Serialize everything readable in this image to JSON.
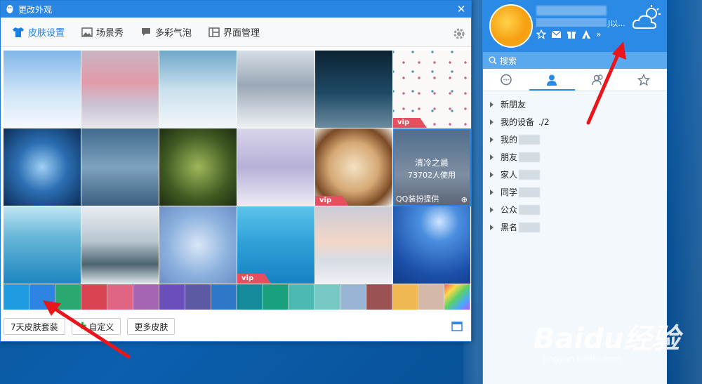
{
  "skin_window": {
    "title": "更改外观",
    "close": "✕",
    "tabs": [
      {
        "label": "皮肤设置",
        "icon": "shirt-icon",
        "active": true
      },
      {
        "label": "场景秀",
        "icon": "picture-icon",
        "active": false
      },
      {
        "label": "多彩气泡",
        "icon": "bubble-icon",
        "active": false
      },
      {
        "label": "界面管理",
        "icon": "layout-icon",
        "active": false
      }
    ],
    "tiles": [
      {
        "name": "sky-clouds",
        "bg": "linear-gradient(180deg,#7fb6e8 0%,#cfe4f7 55%,#f5f9fd 100%)",
        "vip": false
      },
      {
        "name": "snowy-street",
        "bg": "linear-gradient(180deg,#c7b5c4 0%,#e39aa8 40%,#c9c2d3 70%,#e8e6ec 100%)",
        "vip": false
      },
      {
        "name": "snowman",
        "bg": "linear-gradient(180deg,#6fa8c9 0%,#c9e0ee 50%,#f2f6f9 100%)",
        "vip": false
      },
      {
        "name": "snow-forest",
        "bg": "linear-gradient(180deg,#d6dee6 0%,#9aa8b6 45%,#eef1f4 100%)",
        "vip": false
      },
      {
        "name": "night-lamp",
        "bg": "linear-gradient(180deg,#0c2233 0%,#1f4a66 55%,#6b8ba0 100%)",
        "vip": false
      },
      {
        "name": "dots-pattern",
        "bg": "#fbf8f8",
        "vip": true
      },
      {
        "name": "snowflake-blue",
        "bg": "radial-gradient(circle at 50% 50%,#9fd0f5 0%,#2c6fb3 45%,#0b2d58 100%)",
        "vip": false
      },
      {
        "name": "merry-christmas",
        "bg": "linear-gradient(180deg,#3f6a8e 0%,#7fa2be 50%,#3c5f80 100%)",
        "vip": false
      },
      {
        "name": "pine-branch",
        "bg": "radial-gradient(circle at 50% 50%,#9fb75a 0%,#3f5a22 60%,#1e2d12 100%)",
        "vip": false
      },
      {
        "name": "couple-snow",
        "bg": "linear-gradient(180deg,#d8d4ea 0%,#b7b0d8 50%,#ecebf5 100%)",
        "vip": false
      },
      {
        "name": "latte-snowflake",
        "bg": "radial-gradient(circle at 50% 50%,#f3e2c4 0%,#d6a975 45%,#7a4a25 75%,#efe8df 100%)",
        "vip": true
      },
      {
        "name": "cold-morning",
        "bg": "linear-gradient(180deg,#4f6d8c 0%,#7e8ea2 60%,#5b6677 100%)",
        "vip": false,
        "selected": true,
        "title": "清冷之晨",
        "sub": "73702人使用",
        "provider": "QQ装扮提供",
        "zoom": "⊕"
      },
      {
        "name": "frozen-tree",
        "bg": "linear-gradient(180deg,#bfe6f3 0%,#66b6d8 40%,#1e86bf 100%)",
        "vip": false
      },
      {
        "name": "winter-lake",
        "bg": "linear-gradient(180deg,#e9eef2 0%,#b8c6d0 45%,#4c6470 75%,#dfe6ea 100%)",
        "vip": false
      },
      {
        "name": "bird-berries",
        "bg": "radial-gradient(circle at 50% 50%,#d9e6f6 0%,#8db2de 55%,#6b8fc8 100%)",
        "vip": false
      },
      {
        "name": "feather",
        "bg": "linear-gradient(180deg,#5cc3ea 0%,#2d9fd6 50%,#1781c4 100%)",
        "vip": true
      },
      {
        "name": "sunset-boardwalk",
        "bg": "linear-gradient(180deg,#c9ccd8 0%,#f1d6c6 45%,#d8dce5 70%,#eef0f4 100%)",
        "vip": false
      },
      {
        "name": "moon-reindeer",
        "bg": "radial-gradient(circle at 60% 20%,#cfe6ff 0%,#4b8fe0 25%,#1b4fa8 70%,#113b87 100%)",
        "vip": false
      }
    ],
    "swatches": [
      "#1f9be0",
      "#2d84e2",
      "#2ba870",
      "#d94452",
      "#e06585",
      "#a565b0",
      "#6a4fbb",
      "#5b5aa3",
      "#2f78c8",
      "#148a9a",
      "#1aa07c",
      "#4eb8b3",
      "#78c7c7",
      "#98b4d3",
      "#9a5253",
      "#efb850",
      "#d3b8a8",
      "#ff6b6b"
    ],
    "buttons": {
      "seven_day": "7天皮肤套装",
      "custom": "自定义",
      "more": "更多皮肤"
    }
  },
  "qq_panel": {
    "sign_suffix": "J以...",
    "search_placeholder": "搜索",
    "groups": [
      "新朋友",
      "我的设备",
      "我的",
      "朋友",
      "家人",
      "同学",
      "公众",
      "黑名"
    ],
    "device_count": "./2"
  },
  "watermark": {
    "logo": "Baidu经验",
    "sub": "jingyan.baidu.com"
  }
}
